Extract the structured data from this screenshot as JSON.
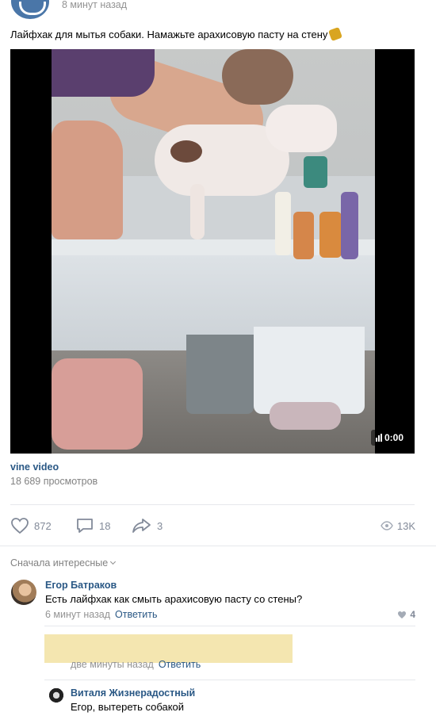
{
  "post": {
    "time": "8 минут назад",
    "text": "Лайфхак для мытья собаки. Намажьте арахисовую пасту на стену",
    "video": {
      "duration": "0:00",
      "source": "vine video",
      "views": "18 689 просмотров"
    },
    "actions": {
      "likes": "872",
      "comments": "18",
      "shares": "3",
      "views": "13K"
    }
  },
  "comments_sort": "Сначала интересные",
  "comments": [
    {
      "author": "Егор Батраков",
      "text": "Есть лайфхак как смыть арахисовую пасту со стены?",
      "time": "6 минут назад",
      "reply_label": "Ответить",
      "likes": "4"
    },
    {
      "time": "две минуты назад",
      "reply_label": "Ответить"
    },
    {
      "author": "Виталя Жизнерадостный",
      "text": "Егор, вытереть собакой"
    }
  ],
  "colors": {
    "link": "#2a5885",
    "muted": "#939393",
    "action": "#828a99",
    "censor": "#f4e6b0"
  }
}
